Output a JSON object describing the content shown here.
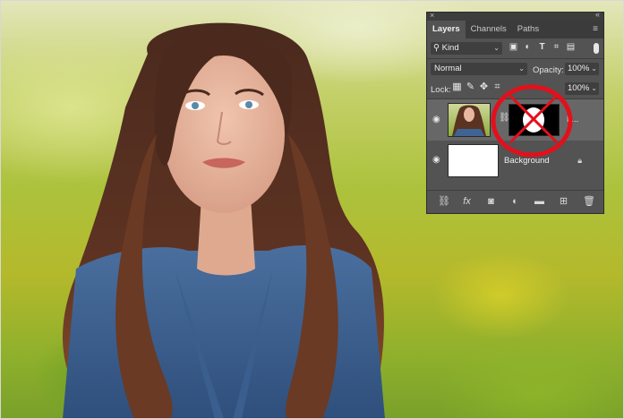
{
  "panel": {
    "tabs": [
      {
        "label": "Layers"
      },
      {
        "label": "Channels"
      },
      {
        "label": "Paths"
      }
    ],
    "filter": {
      "label": "Kind"
    },
    "blend_mode": "Normal",
    "opacity": {
      "label": "Opacity:",
      "value": "100%"
    },
    "lock": {
      "label": "Lock:"
    },
    "fill": {
      "value": "100%"
    },
    "layers": [
      {
        "name": "L...",
        "selected": true,
        "has_mask": true,
        "visible": true
      },
      {
        "name": "Background",
        "selected": false,
        "locked": true,
        "visible": true
      }
    ]
  },
  "annotation": {
    "color": "#e3101b",
    "mark": "crossed-out mask thumbnail"
  }
}
